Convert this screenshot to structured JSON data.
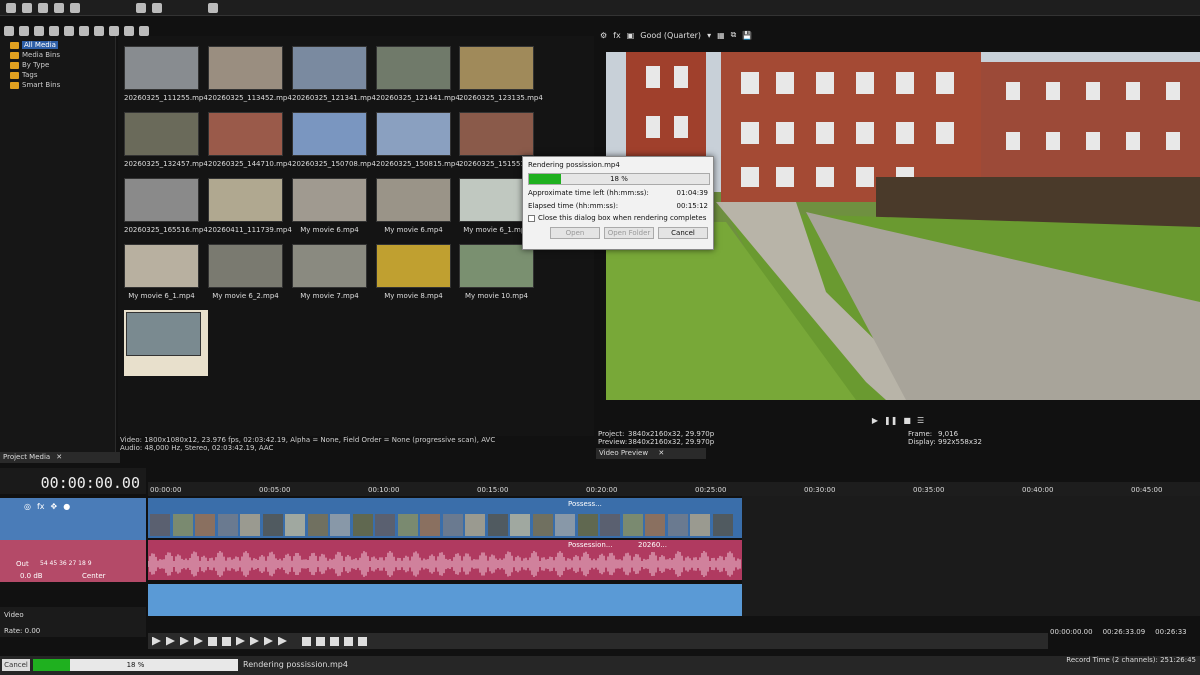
{
  "tree": {
    "items": [
      {
        "label": "All Media",
        "selected": true
      },
      {
        "label": "Media Bins"
      },
      {
        "label": "By Type"
      },
      {
        "label": "Tags"
      },
      {
        "label": "Smart Bins"
      }
    ]
  },
  "media": {
    "items": [
      {
        "caption": "20260325_111255.mp4",
        "color": "#888c90"
      },
      {
        "caption": "20260325_113452.mp4",
        "color": "#9a8e80"
      },
      {
        "caption": "20260325_121341.mp4",
        "color": "#7a8aa0"
      },
      {
        "caption": "20260325_121441.mp4",
        "color": "#707a6a"
      },
      {
        "caption": "20260325_123135.mp4",
        "color": "#a08a5a"
      },
      {
        "caption": "20260325_132457.mp4",
        "color": "#6a6a5a"
      },
      {
        "caption": "20260325_144710.mp4",
        "color": "#9a5a4a"
      },
      {
        "caption": "20260325_150708.mp4",
        "color": "#7a96c0"
      },
      {
        "caption": "20260325_150815.mp4",
        "color": "#8aa0c0"
      },
      {
        "caption": "20260325_151551.mp4",
        "color": "#8a5a4a"
      },
      {
        "caption": "20260325_165516.mp4",
        "color": "#8a8a8a"
      },
      {
        "caption": "20260411_111739.mp4",
        "color": "#b0a890"
      },
      {
        "caption": "My movie 6.mp4",
        "color": "#a09a90"
      },
      {
        "caption": "My movie 6.mp4",
        "color": "#9a9488"
      },
      {
        "caption": "My movie 6_1.mp4",
        "color": "#c0c8c0"
      },
      {
        "caption": "My movie 6_1.mp4",
        "color": "#b8b0a0"
      },
      {
        "caption": "My movie 6_2.mp4",
        "color": "#7a7a70"
      },
      {
        "caption": "My movie 7.mp4",
        "color": "#8a8a80"
      },
      {
        "caption": "My movie 8.mp4",
        "color": "#c0a030"
      },
      {
        "caption": "My movie 10.mp4",
        "color": "#7a9070"
      },
      {
        "caption": "",
        "color": "#7a8a90"
      }
    ],
    "info_line1": "Video: 1800x1080x12, 23.976 fps, 02:03:42.19, Alpha = None, Field Order = None (progressive scan), AVC",
    "info_line2": "Audio: 48,000 Hz, Stereo, 02:03:42.19, AAC"
  },
  "tabs": {
    "project_media": "Project Media",
    "video_preview": "Video Preview"
  },
  "preview": {
    "quality": "Good (Quarter)",
    "project_label": "Project:",
    "project_value": "3840x2160x32, 29.970p",
    "preview_label": "Preview:",
    "preview_value": "3840x2160x32, 29.970p",
    "frame_label": "Frame:",
    "frame_value": "9,016",
    "display_label": "Display:",
    "display_value": "992x558x32"
  },
  "dialog": {
    "title": "Rendering possission.mp4",
    "progress_text": "18 %",
    "progress": 0.18,
    "time_left_label": "Approximate time left (hh:mm:ss):",
    "time_left": "01:04:39",
    "elapsed_label": "Elapsed time (hh:mm:ss):",
    "elapsed": "00:15:12",
    "close_checkbox": "Close this dialog box when rendering completes",
    "btn_open": "Open",
    "btn_open_folder": "Open Folder",
    "btn_cancel": "Cancel"
  },
  "timeline": {
    "timecode": "00:00:00.00",
    "ruler": [
      "00:00:00",
      "00:05:00",
      "00:10:00",
      "00:15:00",
      "00:20:00",
      "00:25:00",
      "00:30:00",
      "00:35:00",
      "00:40:00",
      "00:45:00"
    ],
    "clip_label_1": "Possess...",
    "clip_label_2": "Possession...",
    "clip_label_3": "20260...",
    "audio_out": "Out",
    "audio_db": "0.0 dB",
    "audio_pan": "Center",
    "audio_meter": "54  45  36  27  18  9",
    "video_label": "Video",
    "rate_label": "Rate: 0.00",
    "tc_start": "00:00:00.00",
    "tc_end": "00:26:33.09",
    "tc_extra": "00:26:33"
  },
  "status": {
    "cancel": "Cancel",
    "progress_text": "18 %",
    "progress": 0.18,
    "message": "Rendering possission.mp4",
    "record_time": "Record Time (2 channels): 251:26:45"
  }
}
